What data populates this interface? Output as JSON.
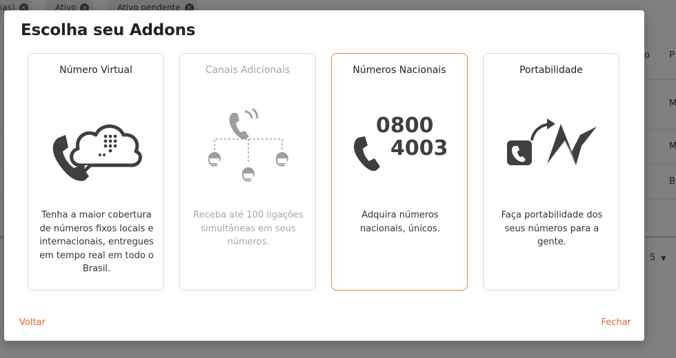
{
  "background": {
    "chips": [
      {
        "label": "ias)"
      },
      {
        "label": "Ativo"
      },
      {
        "label": "Ativo pendente"
      }
    ],
    "column_fragments": [
      "o",
      "P"
    ],
    "row_fragments": [
      "M",
      "M",
      "B"
    ],
    "pagination_value": "5"
  },
  "modal": {
    "title": "Escolha seu Addons",
    "cards": [
      {
        "title": "Número Virtual",
        "icon": "phone-cloud-icon",
        "description": "Tenha a maior cobertura de números fixos locais e internacionais, entregues em tempo real em todo o Brasil."
      },
      {
        "title": "Canais Adicionais",
        "icon": "phone-channels-icon",
        "description": "Receba até 100 ligações simultâneas em seus números."
      },
      {
        "title": "Números Nacionais",
        "icon": "phone-0800-icon",
        "icon_text_line1": "0800",
        "icon_text_line2": "4003",
        "description": "Adquira números nacionais, únicos."
      },
      {
        "title": "Portabilidade",
        "icon": "portability-icon",
        "description": "Faça portabilidade dos seus números para a gente."
      }
    ],
    "back_label": "Voltar",
    "close_label": "Fechar"
  },
  "colors": {
    "accent": "#e8662a",
    "selected_border": "#e8833a",
    "icon_dark": "#3f3f3f",
    "icon_disabled": "#9e9e9e"
  }
}
